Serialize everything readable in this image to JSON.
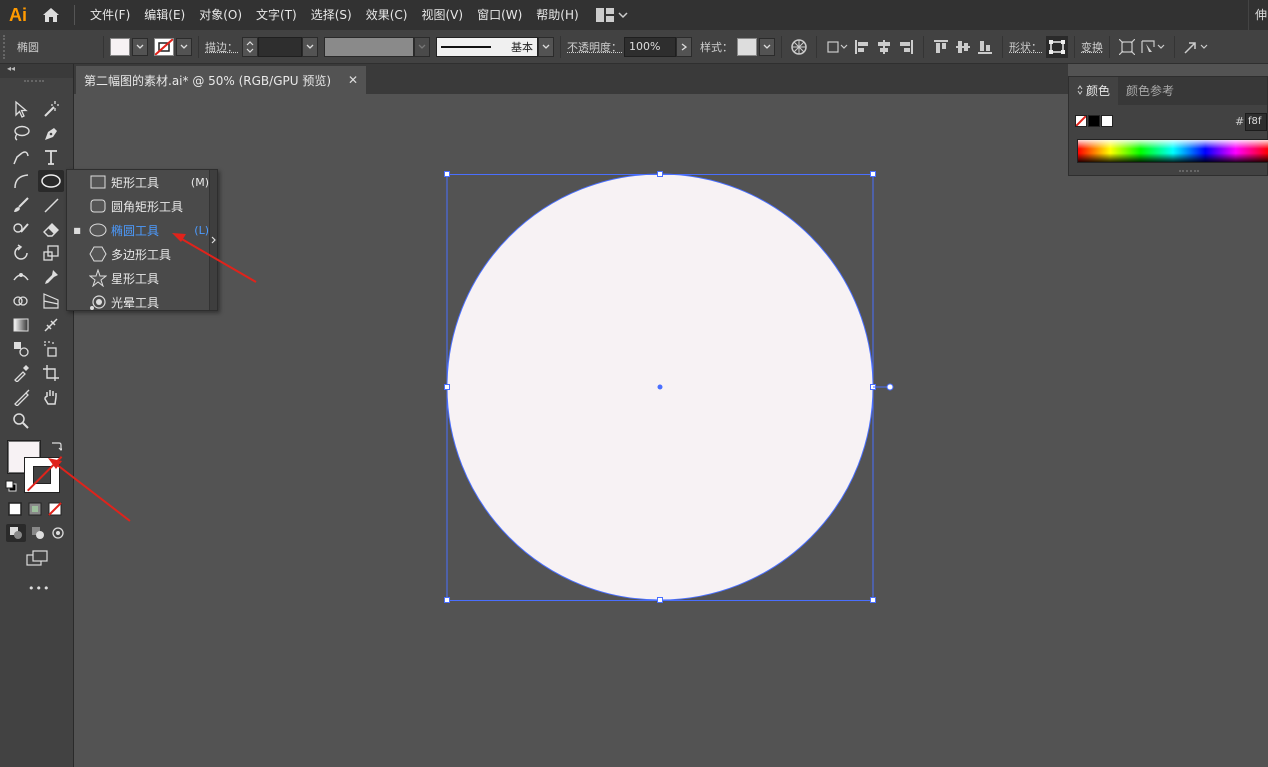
{
  "app": {
    "logo": "Ai",
    "menus": [
      "文件(F)",
      "编辑(E)",
      "对象(O)",
      "文字(T)",
      "选择(S)",
      "效果(C)",
      "视图(V)",
      "窗口(W)",
      "帮助(H)"
    ],
    "right_text": "伸"
  },
  "control_bar": {
    "object_label": "椭圆",
    "stroke_label": "描边：",
    "stroke_profile": "基本",
    "opacity_label": "不透明度：",
    "opacity_value": "100%",
    "style_label": "样式：",
    "shape_label": "形状：",
    "transform_label": "变换",
    "fill_color": "#f7f2f4"
  },
  "document": {
    "tab_title": "第二幅图的素材.ai* @ 50% (RGB/GPU 预览)",
    "close_glyph": "✕"
  },
  "toolbox": {
    "collapse_glyph": "◂◂",
    "more_glyph": "•••"
  },
  "flyout": {
    "items": [
      {
        "label": "矩形工具",
        "key": "(M)",
        "icon": "rectangle-icon",
        "selected": false
      },
      {
        "label": "圆角矩形工具",
        "key": "",
        "icon": "rounded-rectangle-icon",
        "selected": false
      },
      {
        "label": "椭圆工具",
        "key": "(L)",
        "icon": "ellipse-icon",
        "selected": true
      },
      {
        "label": "多边形工具",
        "key": "",
        "icon": "polygon-icon",
        "selected": false
      },
      {
        "label": "星形工具",
        "key": "",
        "icon": "star-icon",
        "selected": false
      },
      {
        "label": "光晕工具",
        "key": "",
        "icon": "flare-icon",
        "selected": false
      }
    ],
    "selected_bullet": "■"
  },
  "color_panel": {
    "tab_active": "颜色",
    "tab_other": "颜色参考",
    "hash": "#",
    "hex_value": "f8f"
  },
  "colors": {
    "accent": "#4c9bff",
    "selection": "#4a6fff",
    "annotation_arrow": "#e0231b",
    "shape_fill": "#f7f2f4"
  }
}
